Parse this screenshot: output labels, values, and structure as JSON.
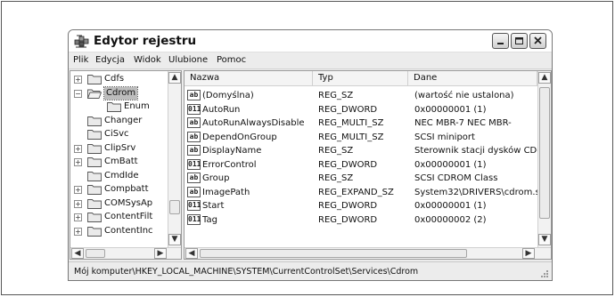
{
  "window": {
    "title": "Edytor rejestru",
    "app_icon": "registry-editor-icon",
    "controls": [
      "minimize-icon",
      "maximize-icon",
      "close-icon"
    ]
  },
  "menu": [
    "Plik",
    "Edycja",
    "Widok",
    "Ulubione",
    "Pomoc"
  ],
  "tree": {
    "items": [
      {
        "label": "Cdfs",
        "expander": "+",
        "selected": false
      },
      {
        "label": "Cdrom",
        "expander": "−",
        "selected": true,
        "open": true
      },
      {
        "label": "Enum",
        "expander": "",
        "selected": false,
        "child": true
      },
      {
        "label": "Changer",
        "expander": "",
        "selected": false
      },
      {
        "label": "CiSvc",
        "expander": "",
        "selected": false
      },
      {
        "label": "ClipSrv",
        "expander": "+",
        "selected": false
      },
      {
        "label": "CmBatt",
        "expander": "+",
        "selected": false
      },
      {
        "label": "CmdIde",
        "expander": "",
        "selected": false
      },
      {
        "label": "Compbatt",
        "expander": "+",
        "selected": false
      },
      {
        "label": "COMSysAp",
        "expander": "+",
        "selected": false
      },
      {
        "label": "ContentFilt",
        "expander": "+",
        "selected": false
      },
      {
        "label": "ContentInc",
        "expander": "+",
        "selected": false
      }
    ]
  },
  "list": {
    "columns": [
      "Nazwa",
      "Typ",
      "Dane"
    ],
    "rows": [
      {
        "icon": "ab",
        "name": "(Domyślna)",
        "type": "REG_SZ",
        "data": "(wartość nie ustalona)"
      },
      {
        "icon": "011",
        "name": "AutoRun",
        "type": "REG_DWORD",
        "data": "0x00000001 (1)"
      },
      {
        "icon": "ab",
        "name": "AutoRunAlwaysDisable",
        "type": "REG_MULTI_SZ",
        "data": "NEC   MBR-7   NEC   MBR-"
      },
      {
        "icon": "ab",
        "name": "DependOnGroup",
        "type": "REG_MULTI_SZ",
        "data": "SCSI miniport"
      },
      {
        "icon": "ab",
        "name": "DisplayName",
        "type": "REG_SZ",
        "data": "Sterownik stacji dysków CD-"
      },
      {
        "icon": "011",
        "name": "ErrorControl",
        "type": "REG_DWORD",
        "data": "0x00000001 (1)"
      },
      {
        "icon": "ab",
        "name": "Group",
        "type": "REG_SZ",
        "data": "SCSI CDROM Class"
      },
      {
        "icon": "ab",
        "name": "ImagePath",
        "type": "REG_EXPAND_SZ",
        "data": "System32\\DRIVERS\\cdrom.s"
      },
      {
        "icon": "011",
        "name": "Start",
        "type": "REG_DWORD",
        "data": "0x00000001 (1)"
      },
      {
        "icon": "011",
        "name": "Tag",
        "type": "REG_DWORD",
        "data": "0x00000002 (2)"
      }
    ]
  },
  "status": {
    "path": "Mój komputer\\HKEY_LOCAL_MACHINE\\SYSTEM\\CurrentControlSet\\Services\\Cdrom"
  },
  "colors": {
    "selection": "#bdbdbd",
    "chrome": "#ececec"
  }
}
